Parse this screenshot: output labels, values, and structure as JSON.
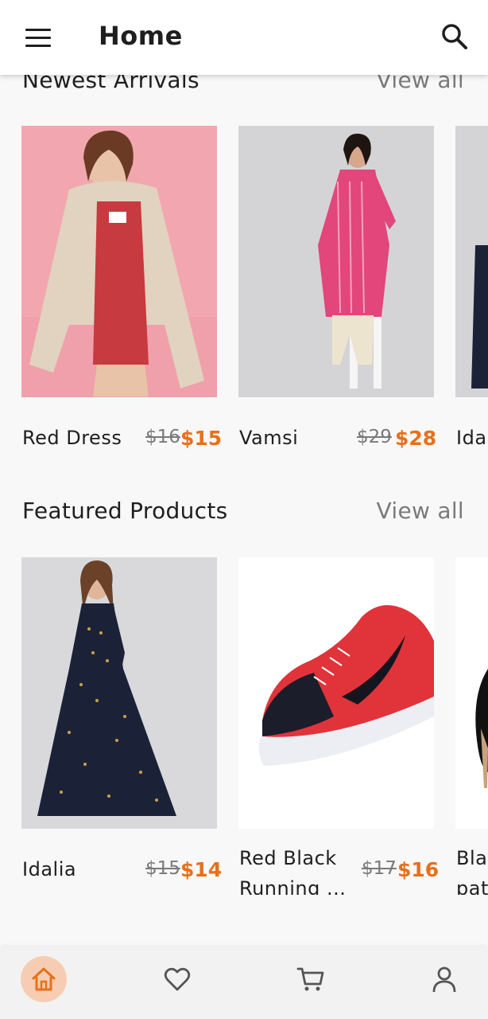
{
  "app_bar": {
    "title": "Home",
    "menu_icon": "hamburger-menu-icon",
    "search_icon": "search-icon"
  },
  "sections": [
    {
      "title": "Newest Arrivals",
      "view_all": "View all",
      "products": [
        {
          "name": "Red Dress",
          "old_price": "$16",
          "price": "$15"
        },
        {
          "name": "Vamsi",
          "old_price": "$29",
          "price": "$28"
        },
        {
          "name": "Ida"
        }
      ]
    },
    {
      "title": "Featured Products",
      "view_all": "View all",
      "products": [
        {
          "name": "Idalia",
          "old_price": "$15",
          "price": "$14"
        },
        {
          "name_line1": "Red Black",
          "name_line2": "Running ...",
          "old_price": "$17",
          "price": "$16"
        },
        {
          "name_line1": "Bla",
          "name_line2": "pat"
        }
      ]
    }
  ],
  "bottom_nav": {
    "items": [
      {
        "icon": "home-icon",
        "active": true
      },
      {
        "icon": "heart-icon",
        "active": false
      },
      {
        "icon": "cart-icon",
        "active": false
      },
      {
        "icon": "profile-icon",
        "active": false
      }
    ],
    "active_color": "#e8701a",
    "active_bg": "#f6cdb2"
  },
  "colors": {
    "price": "#e8701a",
    "strikethrough": "#7a7a7a",
    "background": "#f8f8f8"
  }
}
